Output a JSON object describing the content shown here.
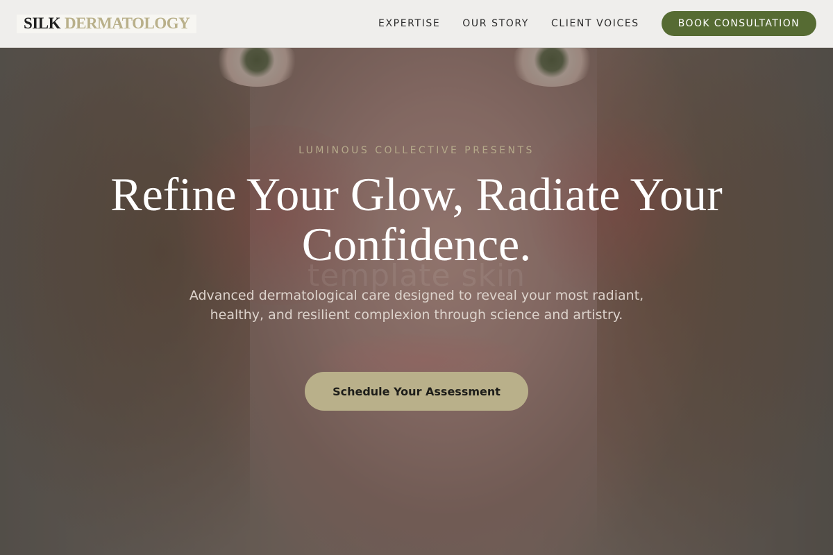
{
  "brand": {
    "name_part1": "SILK",
    "name_part2": "DERMATOLOGY"
  },
  "nav": {
    "links": [
      "EXPERTISE",
      "OUR STORY",
      "CLIENT VOICES"
    ],
    "cta_label": "BOOK CONSULTATION"
  },
  "hero": {
    "eyebrow": "LUMINOUS COLLECTIVE PRESENTS",
    "headline": "Refine Your Glow, Radiate Your Confidence.",
    "watermark": "template skin",
    "subtext": "Advanced dermatological care designed to reveal your most radiant, healthy, and resilient complexion through science and artistry.",
    "cta_label": "Schedule Your Assessment",
    "image": "portrait-woman-face"
  },
  "colors": {
    "brand_dark": "#1f1f1f",
    "brand_accent": "#b9b08a",
    "nav_cta_bg": "#566b33",
    "hero_cta_bg": "#b9b08a",
    "eyebrow": "#b5a98a"
  }
}
